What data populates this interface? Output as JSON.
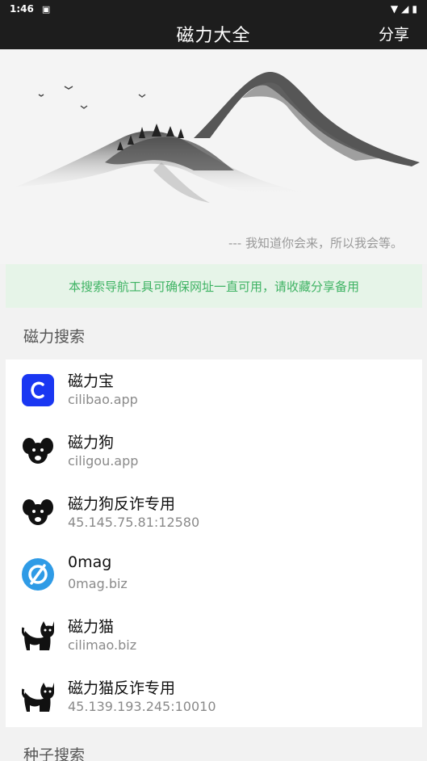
{
  "status": {
    "time": "1:46"
  },
  "app_bar": {
    "title": "磁力大全",
    "share_label": "分享"
  },
  "hero": {
    "quote": "--- 我知道你会来，所以我会等。"
  },
  "notice": {
    "text": "本搜索导航工具可确保网址一直可用，请收藏分享备用"
  },
  "sections": [
    {
      "title": "磁力搜索"
    },
    {
      "title": "种子搜索"
    }
  ],
  "items": [
    {
      "name": "磁力宝",
      "url": "cilibao.app",
      "icon": "letter-c-icon"
    },
    {
      "name": "磁力狗",
      "url": "ciligou.app",
      "icon": "dog-face-icon"
    },
    {
      "name": "磁力狗反诈专用",
      "url": "45.145.75.81:12580",
      "icon": "dog-face-icon"
    },
    {
      "name": "0mag",
      "url": "0mag.biz",
      "icon": "empty-set-icon"
    },
    {
      "name": "磁力猫",
      "url": "cilimao.biz",
      "icon": "cat-icon"
    },
    {
      "name": "磁力猫反诈专用",
      "url": "45.139.193.245:10010",
      "icon": "cat-icon"
    }
  ],
  "colors": {
    "bar": "#1d1d1d",
    "notice_bg": "#e6f4e8",
    "notice_text": "#3fb364",
    "cilibao_blue": "#1a37f2",
    "omag_blue": "#2f9be6"
  }
}
